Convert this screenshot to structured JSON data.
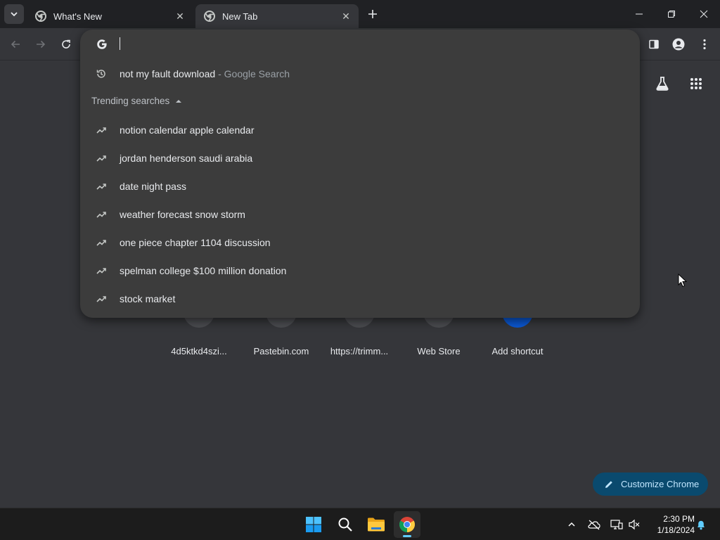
{
  "tabs": [
    {
      "title": "What's New",
      "active": false
    },
    {
      "title": "New Tab",
      "active": true
    }
  ],
  "omnibox": {
    "value": "",
    "history_suggestion": {
      "text": "not my fault download",
      "suffix": " - Google Search"
    },
    "trending_header": "Trending searches",
    "trending": [
      "notion calendar apple calendar",
      "jordan henderson saudi arabia",
      "date night pass",
      "weather forecast snow storm",
      "one piece chapter 1104 discussion",
      "spelman college $100 million donation",
      "stock market"
    ]
  },
  "shortcuts": [
    {
      "label": "4d5ktkd4szi..."
    },
    {
      "label": "Pastebin.com"
    },
    {
      "label": "https://trimm..."
    },
    {
      "label": "Web Store"
    },
    {
      "label": "Add shortcut"
    }
  ],
  "customize_label": "Customize Chrome",
  "clock": {
    "time": "2:30 PM",
    "date": "1/18/2024"
  },
  "colors": {
    "accent": "#8ab4f8",
    "customize_bg": "#0a4a6e",
    "taskbar_indicator": "#60cdff"
  }
}
